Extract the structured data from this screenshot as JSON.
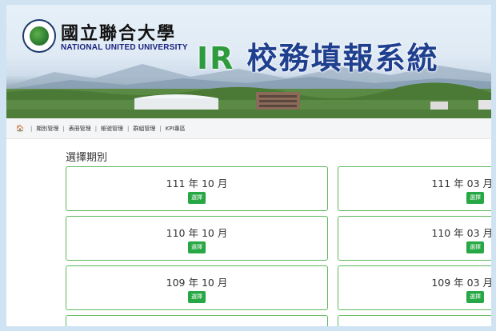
{
  "header": {
    "university_cn": "國立聯合大學",
    "university_en": "NATIONAL UNITED UNIVERSITY",
    "system_prefix": "IR",
    "system_name": "校務填報系統"
  },
  "nav": {
    "home_icon": "home-icon",
    "items": [
      "期別管理",
      "表冊管理",
      "帳號管理",
      "群組管理",
      "KPI專區"
    ],
    "separator": "|"
  },
  "main": {
    "section_title": "選擇期別",
    "select_label": "選擇",
    "periods_left": [
      "111 年 10 月",
      "110 年 10 月",
      "109 年 10 月"
    ],
    "periods_right": [
      "111 年 03 月",
      "110 年 03 月",
      "109 年 03 月"
    ]
  },
  "colors": {
    "accent_green": "#28a745",
    "title_blue": "#1f3f8f",
    "ir_green": "#2e9b3e",
    "card_border": "#5cb85c"
  }
}
